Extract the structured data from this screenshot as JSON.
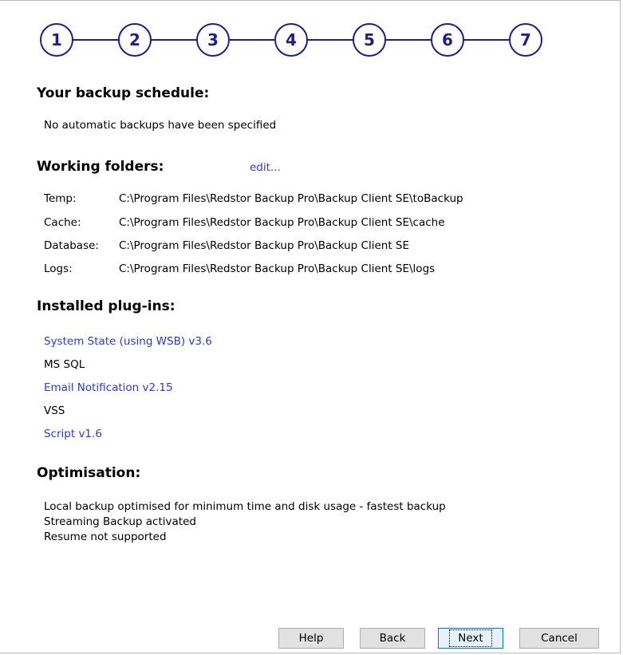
{
  "wizard": {
    "steps": [
      "1",
      "2",
      "3",
      "4",
      "5",
      "6",
      "7"
    ]
  },
  "schedule": {
    "heading": "Your backup schedule:",
    "text": "No automatic backups have been specified"
  },
  "folders": {
    "heading": "Working folders:",
    "edit_link": "edit...",
    "rows": [
      {
        "label": "Temp:",
        "path": "C:\\Program Files\\Redstor Backup Pro\\Backup Client SE\\toBackup"
      },
      {
        "label": "Cache:",
        "path": "C:\\Program Files\\Redstor Backup Pro\\Backup Client SE\\cache"
      },
      {
        "label": "Database:",
        "path": "C:\\Program Files\\Redstor Backup Pro\\Backup Client SE"
      },
      {
        "label": "Logs:",
        "path": "C:\\Program Files\\Redstor Backup Pro\\Backup Client SE\\logs"
      }
    ]
  },
  "plugins": {
    "heading": "Installed plug-ins:",
    "items": [
      {
        "label": "System State (using WSB) v3.6",
        "is_link": true
      },
      {
        "label": "MS SQL",
        "is_link": false
      },
      {
        "label": "Email Notification v2.15",
        "is_link": true
      },
      {
        "label": "VSS",
        "is_link": false
      },
      {
        "label": "Script v1.6",
        "is_link": true
      }
    ]
  },
  "optimisation": {
    "heading": "Optimisation:",
    "lines": [
      "Local backup optimised for minimum time and disk usage - fastest backup",
      "Streaming Backup activated",
      "Resume not supported"
    ]
  },
  "buttons": {
    "help": "Help",
    "back": "Back",
    "next": "Next",
    "cancel": "Cancel"
  },
  "colors": {
    "step_circle": "#1e1e8c",
    "link": "#2a3ad8"
  }
}
